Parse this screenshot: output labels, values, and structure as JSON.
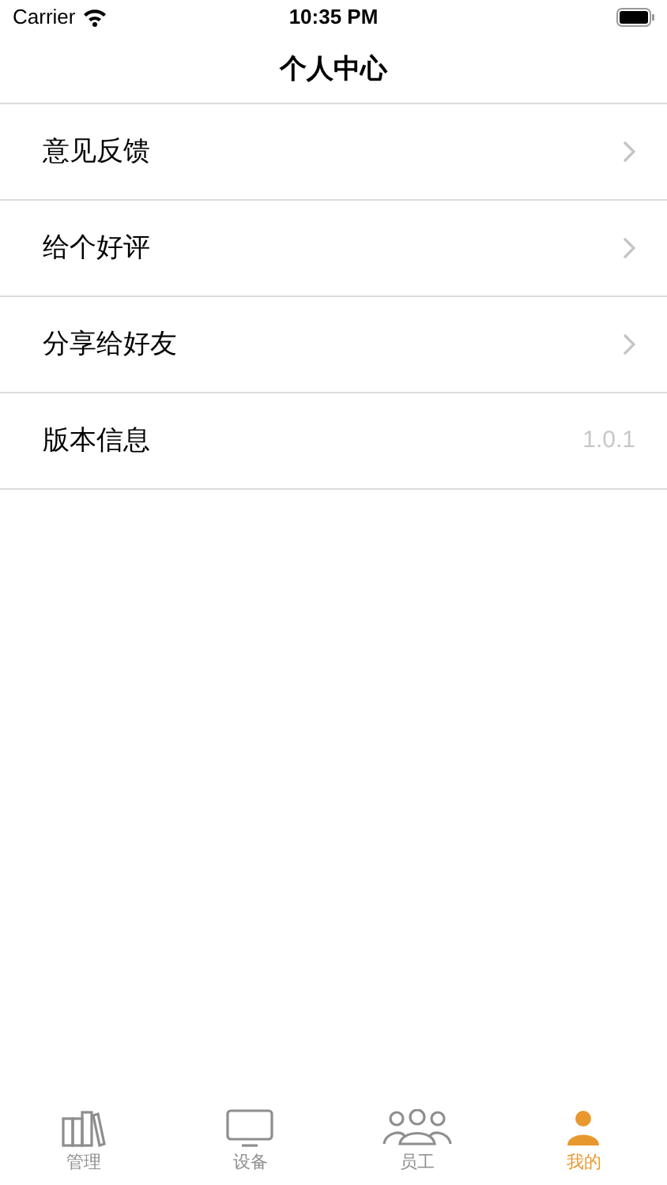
{
  "status_bar": {
    "carrier": "Carrier",
    "time": "10:35 PM"
  },
  "nav": {
    "title": "个人中心"
  },
  "rows": [
    {
      "kind": "link",
      "label": "意见反馈"
    },
    {
      "kind": "link",
      "label": "给个好评"
    },
    {
      "kind": "link",
      "label": "分享给好友"
    },
    {
      "kind": "value",
      "label": "版本信息",
      "value": "1.0.1"
    }
  ],
  "tabs": [
    {
      "kind": "books",
      "label": "管理",
      "selected": false
    },
    {
      "kind": "monitor",
      "label": "设备",
      "selected": false
    },
    {
      "kind": "people",
      "label": "员工",
      "selected": false
    },
    {
      "kind": "person",
      "label": "我的",
      "selected": true
    }
  ]
}
